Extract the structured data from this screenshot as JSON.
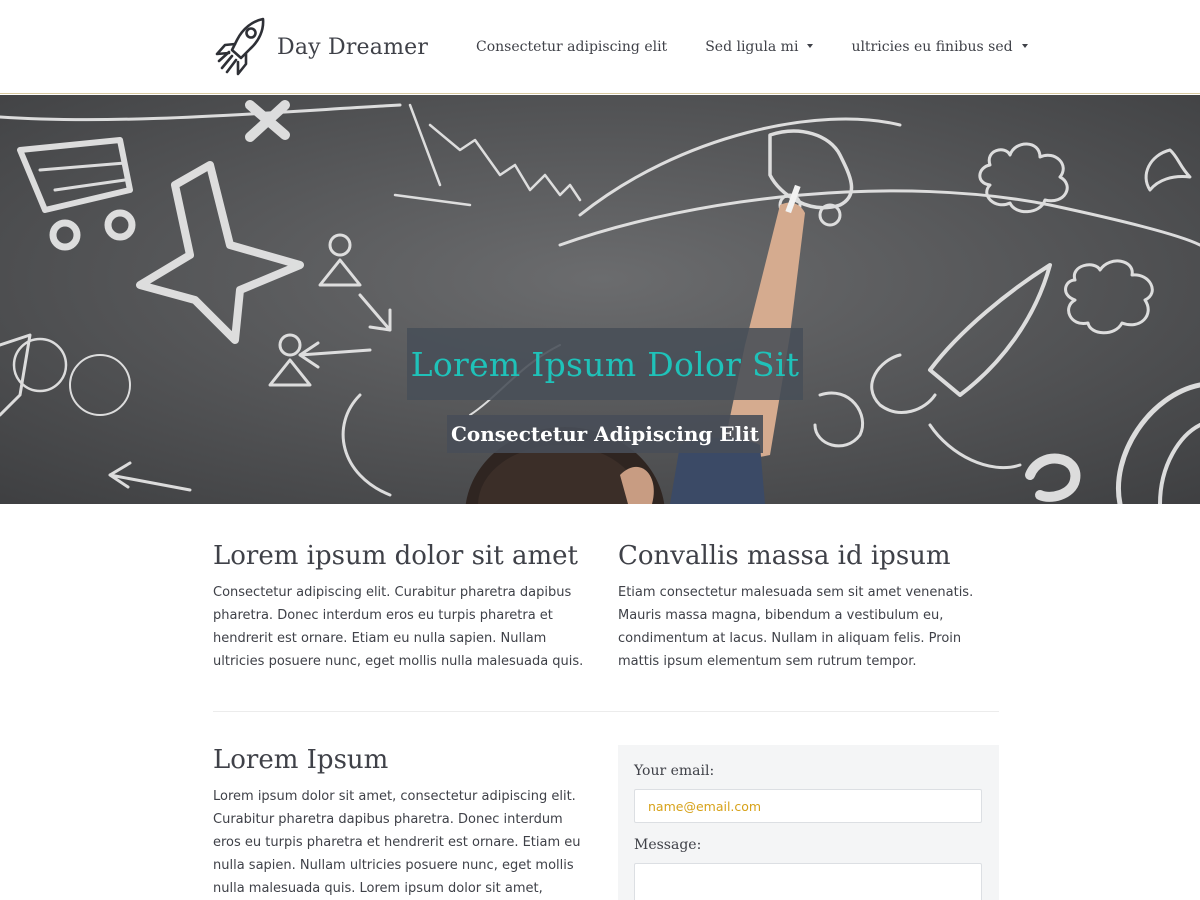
{
  "brand": {
    "name": "Day Dreamer",
    "logo_icon": "rocket-icon"
  },
  "nav": {
    "items": [
      {
        "label": "Consectetur adipiscing elit",
        "dropdown": false
      },
      {
        "label": "Sed ligula mi",
        "dropdown": true
      },
      {
        "label": "ultricies eu finibus sed",
        "dropdown": true
      }
    ]
  },
  "hero": {
    "title": "Lorem Ipsum Dolor Sit",
    "subtitle": "Consectetur Adipiscing Elit",
    "title_color": "#1fc2b9"
  },
  "sections": [
    {
      "heading": "Lorem ipsum dolor sit amet",
      "body": "Consectetur adipiscing elit. Curabitur pharetra dapibus pharetra. Donec interdum eros eu turpis pharetra et hendrerit est ornare. Etiam eu nulla sapien. Nullam ultricies posuere nunc, eget mollis nulla malesuada quis."
    },
    {
      "heading": "Convallis massa id ipsum",
      "body": "Etiam consectetur malesuada sem sit amet venenatis. Mauris massa magna, bibendum a vestibulum eu, condimentum at lacus. Nullam in aliquam felis. Proin mattis ipsum elementum sem rutrum tempor."
    },
    {
      "heading": "Lorem Ipsum",
      "body": "Lorem ipsum dolor sit amet, consectetur adipiscing elit. Curabitur pharetra dapibus pharetra. Donec interdum eros eu turpis pharetra et hendrerit est ornare. Etiam eu nulla sapien. Nullam ultricies posuere nunc, eget mollis nulla malesuada quis. Lorem ipsum dolor sit amet, consectetur adipiscing elit."
    }
  ],
  "contact_form": {
    "email_label": "Your email:",
    "email_placeholder": "name@email.com",
    "message_label": "Message:",
    "placeholder_color": "#d7a21a"
  }
}
